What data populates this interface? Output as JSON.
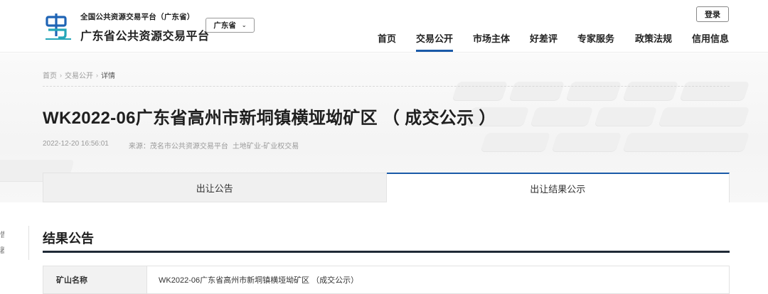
{
  "header": {
    "logo_subtitle": "全国公共资源交易平台（广东省）",
    "logo_title": "广东省公共资源交易平台",
    "region_select": "广东省",
    "login_label": "登录"
  },
  "nav": {
    "items": [
      "首页",
      "交易公开",
      "市场主体",
      "好差评",
      "专家服务",
      "政策法规",
      "信用信息"
    ],
    "active": "交易公开"
  },
  "breadcrumb": [
    "首页",
    "交易公开",
    "详情"
  ],
  "page": {
    "title": "WK2022-06广东省高州市新垌镇横垭坳矿区 （ 成交公示 ）",
    "datetime": "2022-12-20 16:56:01",
    "source_label": "来源：茂名市公共资源交易平台",
    "category": "土地矿业-矿业权交易"
  },
  "tabs": [
    {
      "label": "出让公告",
      "active": false
    },
    {
      "label": "出让结果公示",
      "active": true
    }
  ],
  "side_fragments": [
    "告",
    "器"
  ],
  "section": {
    "title": "结果公告",
    "rows": [
      {
        "label": "矿山名称",
        "value": "WK2022-06广东省高州市新垌镇横垭坳矿区 （成交公示）"
      }
    ]
  },
  "colors": {
    "accent": "#1a5aa8",
    "logo_blue": "#1f64b5",
    "logo_teal": "#24a6b8",
    "rule_dark": "#1f2a36"
  }
}
